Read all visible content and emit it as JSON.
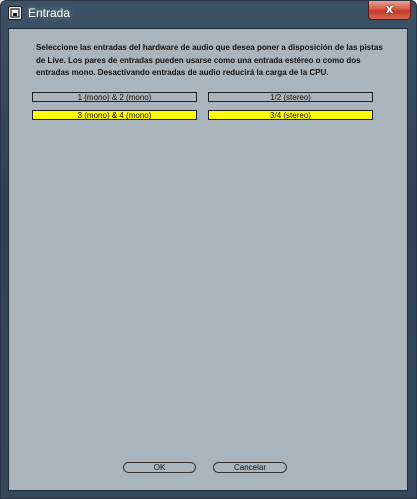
{
  "window": {
    "title": "Entrada",
    "close_glyph": "x",
    "app_icon": "ableton-live-icon"
  },
  "instructions": "Seleccione las entradas del hardware de audio que desea poner a disposición de las pistas de Live. Los pares de entradas pueden usarse como una entrada estéreo o como dos entradas mono. Desactivando entradas de audio reducirá la carga de la CPU.",
  "inputs": {
    "mono": [
      {
        "label": "1 (mono) & 2 (mono)",
        "active": false
      },
      {
        "label": "3 (mono) & 4 (mono)",
        "active": true
      }
    ],
    "stereo": [
      {
        "label": "1/2 (stereo)",
        "active": false
      },
      {
        "label": "3/4 (stereo)",
        "active": true
      }
    ]
  },
  "buttons": {
    "ok": "OK",
    "cancel": "Cancelar"
  },
  "colors": {
    "active": "#ffff00",
    "panel": "#aab4bc",
    "close": "#c13a22"
  }
}
